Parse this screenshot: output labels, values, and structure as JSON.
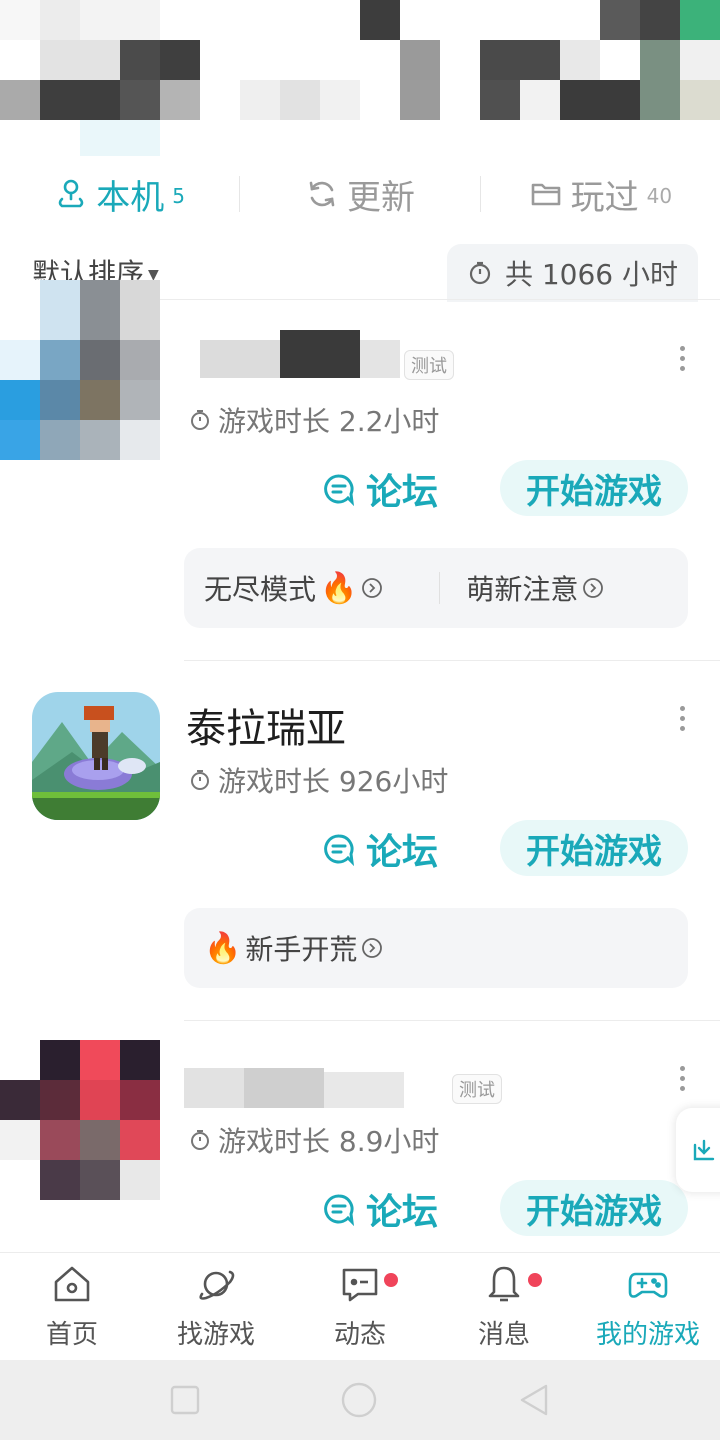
{
  "tabs": [
    {
      "label": "本机",
      "count": "5",
      "icon": "person-pin-icon"
    },
    {
      "label": "更新",
      "count": "",
      "icon": "refresh-icon"
    },
    {
      "label": "玩过",
      "count": "40",
      "icon": "folder-icon"
    }
  ],
  "sort": {
    "label": "默认排序",
    "total": "共 1066 小时"
  },
  "games": [
    {
      "title": "",
      "beta_tag": "测试",
      "playtime": "游戏时长 2.2小时",
      "forum": "论坛",
      "play": "开始游戏",
      "tags": [
        {
          "label": "无尽模式",
          "hot": true
        },
        {
          "label": "萌新注意",
          "hot": false
        }
      ]
    },
    {
      "title": "泰拉瑞亚",
      "beta_tag": "",
      "playtime": "游戏时长 926小时",
      "forum": "论坛",
      "play": "开始游戏",
      "tags": [
        {
          "label": "新手开荒",
          "hot": true
        }
      ]
    },
    {
      "title": "",
      "beta_tag": "测试",
      "playtime": "游戏时长 8.9小时",
      "forum": "论坛",
      "play": "开始游戏",
      "tags": []
    }
  ],
  "nav": [
    {
      "label": "首页",
      "icon": "home-icon",
      "dot": false,
      "active": false
    },
    {
      "label": "找游戏",
      "icon": "planet-icon",
      "dot": false,
      "active": false
    },
    {
      "label": "动态",
      "icon": "chat-card-icon",
      "dot": true,
      "active": false
    },
    {
      "label": "消息",
      "icon": "bell-icon",
      "dot": true,
      "active": false
    },
    {
      "label": "我的游戏",
      "icon": "gamepad-icon",
      "dot": false,
      "active": true
    }
  ],
  "colors": {
    "accent": "#1aa9b9",
    "dot": "#f0445a"
  }
}
